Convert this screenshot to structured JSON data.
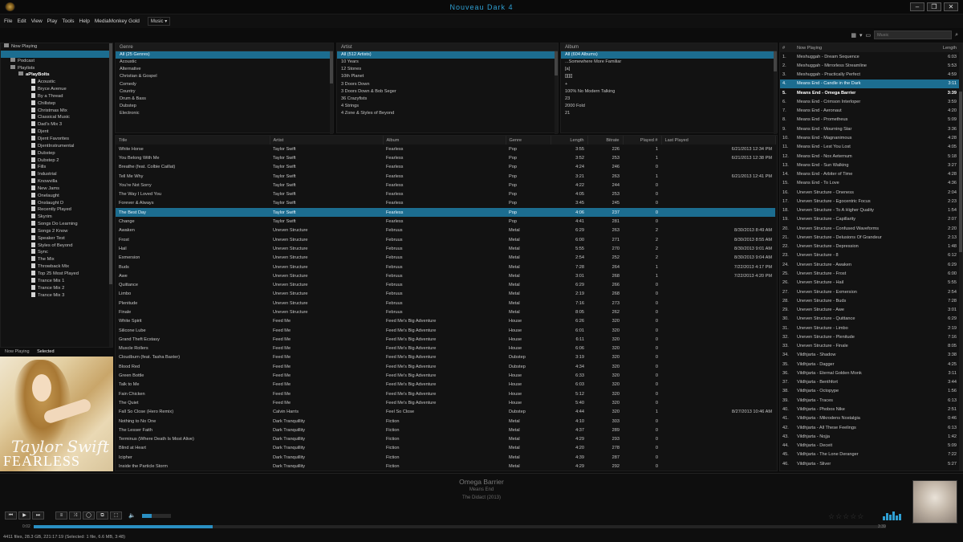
{
  "window": {
    "title": "Nouveau Dark 4"
  },
  "menu": [
    "File",
    "Edit",
    "View",
    "Play",
    "Tools",
    "Help",
    "MediaMonkey Gold"
  ],
  "menu_dropdown": "Music",
  "toolbar": {
    "search_placeholder": "Music"
  },
  "colors": {
    "accent": "#1c6d90",
    "highlight_text": "#2f9fd2",
    "background": "#0c0c0c"
  },
  "tree": {
    "items": [
      {
        "label": "Now Playing",
        "type": "node"
      },
      {
        "label": "",
        "type": "selected"
      },
      {
        "label": "Podcast",
        "type": "node"
      },
      {
        "label": "Playlists",
        "type": "node"
      },
      {
        "label": "aPlayBolts",
        "type": "bold"
      },
      {
        "label": "Acoustic",
        "type": "doc"
      },
      {
        "label": "Bryce Avenue",
        "type": "doc"
      },
      {
        "label": "By a Thread",
        "type": "doc"
      },
      {
        "label": "Chillstep",
        "type": "doc"
      },
      {
        "label": "Christmas Mix",
        "type": "doc"
      },
      {
        "label": "Classical Music",
        "type": "doc"
      },
      {
        "label": "Dad's Mix 3",
        "type": "doc"
      },
      {
        "label": "Djent",
        "type": "doc"
      },
      {
        "label": "Djent Favorites",
        "type": "doc"
      },
      {
        "label": "DjentInstrumental",
        "type": "doc"
      },
      {
        "label": "Dubstep",
        "type": "doc"
      },
      {
        "label": "Dubstep 2",
        "type": "doc"
      },
      {
        "label": "Fills",
        "type": "doc"
      },
      {
        "label": "Industrial",
        "type": "doc"
      },
      {
        "label": "Knowvilla",
        "type": "doc"
      },
      {
        "label": "New Jams",
        "type": "doc"
      },
      {
        "label": "Onelaught",
        "type": "doc"
      },
      {
        "label": "Onslaught D",
        "type": "doc"
      },
      {
        "label": "Recently Played",
        "type": "doc"
      },
      {
        "label": "Skyrim",
        "type": "doc"
      },
      {
        "label": "Songs Do Learning",
        "type": "doc"
      },
      {
        "label": "Songs 2 Know",
        "type": "doc"
      },
      {
        "label": "Speaker Test",
        "type": "doc"
      },
      {
        "label": "Styles of Beyond",
        "type": "doc"
      },
      {
        "label": "Sync",
        "type": "doc"
      },
      {
        "label": "The Mix",
        "type": "doc"
      },
      {
        "label": "Throwback Mix",
        "type": "doc"
      },
      {
        "label": "Top 25 Most Played",
        "type": "doc"
      },
      {
        "label": "Trance Mix 1",
        "type": "doc"
      },
      {
        "label": "Trance Mix 2",
        "type": "doc"
      },
      {
        "label": "Trance Mix 3",
        "type": "doc"
      }
    ]
  },
  "side_tabs": {
    "now_playing": "Now Playing",
    "selected": "Selected"
  },
  "album_art": {
    "signature": "Taylor Swift",
    "title": "FEARLESS"
  },
  "filters": {
    "genre": {
      "header": "Genre",
      "items": [
        "All (25 Genres)",
        "Acoustic",
        "Alternative",
        "Christian & Gospel",
        "Comedy",
        "Country",
        "Drum & Bass",
        "Dubstep",
        "Electronic"
      ]
    },
    "artist": {
      "header": "Artist",
      "items": [
        "All (512 Artists)",
        "10 Years",
        "12 Stones",
        "10th Planet",
        "3 Doors Down",
        "3 Doors Down & Bob Seger",
        "36 Crazyfists",
        "4 Strings",
        "4 Zone & Styles of Beyond"
      ]
    },
    "album": {
      "header": "Album",
      "items": [
        "All (604 Albums)",
        "...Somewhere More Familiar",
        "[a]",
        "[][][]",
        "+",
        "100% No Modern Talking",
        "23",
        "2000 Fold",
        "21"
      ]
    }
  },
  "tracklist": {
    "columns": [
      "Title",
      "Artist",
      "Album",
      "Genre",
      "Length",
      "Bitrate",
      "Played #",
      "Last Played"
    ],
    "selected_index": 7,
    "rows": [
      [
        "White Horse",
        "Taylor Swift",
        "Fearless",
        "Pop",
        "3:55",
        "226",
        "1",
        "6/21/2013 12:34 PM"
      ],
      [
        "You Belong With Me",
        "Taylor Swift",
        "Fearless",
        "Pop",
        "3:52",
        "253",
        "1",
        "6/21/2013 12:38 PM"
      ],
      [
        "Breathe (feat. Colbie Caillat)",
        "Taylor Swift",
        "Fearless",
        "Pop",
        "4:24",
        "246",
        "0",
        ""
      ],
      [
        "Tell Me Why",
        "Taylor Swift",
        "Fearless",
        "Pop",
        "3:21",
        "263",
        "1",
        "6/21/2013 12:41 PM"
      ],
      [
        "You're Not Sorry",
        "Taylor Swift",
        "Fearless",
        "Pop",
        "4:22",
        "244",
        "0",
        ""
      ],
      [
        "The Way I Loved You",
        "Taylor Swift",
        "Fearless",
        "Pop",
        "4:05",
        "253",
        "0",
        ""
      ],
      [
        "Forever & Always",
        "Taylor Swift",
        "Fearless",
        "Pop",
        "3:45",
        "245",
        "0",
        ""
      ],
      [
        "The Best Day",
        "Taylor Swift",
        "Fearless",
        "Pop",
        "4:06",
        "237",
        "0",
        ""
      ],
      [
        "Change",
        "Taylor Swift",
        "Fearless",
        "Pop",
        "4:41",
        "281",
        "0",
        ""
      ],
      [
        "Awaken",
        "Uneven Structure",
        "Februus",
        "Metal",
        "6:29",
        "263",
        "2",
        "8/30/2013 8:49 AM"
      ],
      [
        "Frost",
        "Uneven Structure",
        "Februus",
        "Metal",
        "6:00",
        "271",
        "2",
        "8/30/2013 8:55 AM"
      ],
      [
        "Hail",
        "Uneven Structure",
        "Februus",
        "Metal",
        "5:55",
        "270",
        "2",
        "8/30/2013 9:01 AM"
      ],
      [
        "Exmersion",
        "Uneven Structure",
        "Februus",
        "Metal",
        "2:54",
        "252",
        "2",
        "8/30/2013 9:04 AM"
      ],
      [
        "Buds",
        "Uneven Structure",
        "Februus",
        "Metal",
        "7:28",
        "264",
        "1",
        "7/22/2013 4:17 PM"
      ],
      [
        "Awe",
        "Uneven Structure",
        "Februus",
        "Metal",
        "3:01",
        "268",
        "1",
        "7/22/2013 4:20 PM"
      ],
      [
        "Quittance",
        "Uneven Structure",
        "Februus",
        "Metal",
        "6:29",
        "266",
        "0",
        ""
      ],
      [
        "Limbo",
        "Uneven Structure",
        "Februus",
        "Metal",
        "2:19",
        "268",
        "0",
        ""
      ],
      [
        "Plenitude",
        "Uneven Structure",
        "Februus",
        "Metal",
        "7:16",
        "273",
        "0",
        ""
      ],
      [
        "Finale",
        "Uneven Structure",
        "Februus",
        "Metal",
        "8:05",
        "262",
        "0",
        ""
      ],
      [
        "White Spirit",
        "Feed Me",
        "Feed Me's Big Adventure",
        "House",
        "6:26",
        "320",
        "0",
        ""
      ],
      [
        "Silicone Lube",
        "Feed Me",
        "Feed Me's Big Adventure",
        "House",
        "6:01",
        "320",
        "0",
        ""
      ],
      [
        "Grand Theft Ecstasy",
        "Feed Me",
        "Feed Me's Big Adventure",
        "House",
        "6:11",
        "320",
        "0",
        ""
      ],
      [
        "Muscle Rollers",
        "Feed Me",
        "Feed Me's Big Adventure",
        "House",
        "6:06",
        "320",
        "0",
        ""
      ],
      [
        "Cloudburn (feat. Tasha Baxter)",
        "Feed Me",
        "Feed Me's Big Adventure",
        "Dubstep",
        "3:19",
        "320",
        "0",
        ""
      ],
      [
        "Blood Red",
        "Feed Me",
        "Feed Me's Big Adventure",
        "Dubstep",
        "4:34",
        "320",
        "0",
        ""
      ],
      [
        "Green Bottle",
        "Feed Me",
        "Feed Me's Big Adventure",
        "House",
        "6:33",
        "320",
        "0",
        ""
      ],
      [
        "Talk to Me",
        "Feed Me",
        "Feed Me's Big Adventure",
        "House",
        "6:03",
        "320",
        "0",
        ""
      ],
      [
        "Fain Chicken",
        "Feed Me",
        "Feed Me's Big Adventure",
        "House",
        "5:12",
        "320",
        "0",
        ""
      ],
      [
        "The Quiet",
        "Feed Me",
        "Feed Me's Big Adventure",
        "House",
        "5:40",
        "320",
        "0",
        ""
      ],
      [
        "Fall So Close (Hero Remix)",
        "Calvin Harris",
        "Feel So Close",
        "Dubstep",
        "4:44",
        "320",
        "1",
        "8/27/2013 10:46 AM"
      ],
      [
        "Nothing to No One",
        "Dark Tranquillity",
        "Fiction",
        "Metal",
        "4:10",
        "303",
        "0",
        ""
      ],
      [
        "The Lesser Faith",
        "Dark Tranquillity",
        "Fiction",
        "Metal",
        "4:37",
        "289",
        "0",
        ""
      ],
      [
        "Terminus (Where Death Is Most Alive)",
        "Dark Tranquillity",
        "Fiction",
        "Metal",
        "4:29",
        "293",
        "0",
        ""
      ],
      [
        "Blind at Heart",
        "Dark Tranquillity",
        "Fiction",
        "Metal",
        "4:20",
        "278",
        "0",
        ""
      ],
      [
        "Icipher",
        "Dark Tranquillity",
        "Fiction",
        "Metal",
        "4:39",
        "287",
        "0",
        ""
      ],
      [
        "Inside the Particle Storm",
        "Dark Tranquillity",
        "Fiction",
        "Metal",
        "4:29",
        "292",
        "0",
        ""
      ]
    ]
  },
  "nowplaying": {
    "columns": [
      "#",
      "Now Playing",
      "Length"
    ],
    "selected_index": 3,
    "bold_index": 4,
    "rows": [
      [
        "1.",
        "Meshuggah - Dream Sequence",
        "6:03"
      ],
      [
        "2.",
        "Meshuggah - Mirrorless Streamline",
        "5:53"
      ],
      [
        "3.",
        "Meshuggah - Practically Perfect",
        "4:59"
      ],
      [
        "4.",
        "Means End - Candle in the Dark",
        "3:11"
      ],
      [
        "5.",
        "Means End - Omega Barrier",
        "3:39"
      ],
      [
        "6.",
        "Means End - Crimson Interloper",
        "3:59"
      ],
      [
        "7.",
        "Means End - Aeronaut",
        "4:20"
      ],
      [
        "8.",
        "Means End - Prometheus",
        "5:09"
      ],
      [
        "9.",
        "Means End - Mourning Star",
        "3:36"
      ],
      [
        "10.",
        "Means End - Magnanimous",
        "4:28"
      ],
      [
        "11.",
        "Means End - Lest You Lost",
        "4:05"
      ],
      [
        "12.",
        "Means End - Nox Aeternum",
        "5:18"
      ],
      [
        "13.",
        "Means End - Sun Walking",
        "3:27"
      ],
      [
        "14.",
        "Means End - Arbiter of Time",
        "4:28"
      ],
      [
        "15.",
        "Means End - To Love",
        "4:36"
      ],
      [
        "16.",
        "Uneven Structure - Oneness",
        "2:04"
      ],
      [
        "17.",
        "Uneven Structure - Egocentric Focus",
        "2:23"
      ],
      [
        "18.",
        "Uneven Structure - To A Higher Quality",
        "1:54"
      ],
      [
        "19.",
        "Uneven Structure - Capillarity",
        "2:07"
      ],
      [
        "20.",
        "Uneven Structure - Confused Waveforms",
        "2:20"
      ],
      [
        "21.",
        "Uneven Structure - Delusions Of Grandeur",
        "2:13"
      ],
      [
        "22.",
        "Uneven Structure - Depression",
        "1:48"
      ],
      [
        "23.",
        "Uneven Structure - 8",
        "6:12"
      ],
      [
        "24.",
        "Uneven Structure - Awaken",
        "6:29"
      ],
      [
        "25.",
        "Uneven Structure - Frost",
        "6:00"
      ],
      [
        "26.",
        "Uneven Structure - Hail",
        "5:55"
      ],
      [
        "27.",
        "Uneven Structure - Exmersion",
        "2:54"
      ],
      [
        "28.",
        "Uneven Structure - Buds",
        "7:28"
      ],
      [
        "29.",
        "Uneven Structure - Awe",
        "3:01"
      ],
      [
        "30.",
        "Uneven Structure - Quittance",
        "6:29"
      ],
      [
        "31.",
        "Uneven Structure - Limbo",
        "2:19"
      ],
      [
        "32.",
        "Uneven Structure - Plenitude",
        "7:16"
      ],
      [
        "33.",
        "Uneven Structure - Finale",
        "8:05"
      ],
      [
        "34.",
        "Vildhjarta - Shadow",
        "3:38"
      ],
      [
        "35.",
        "Vildhjarta - Dagger",
        "4:25"
      ],
      [
        "36.",
        "Vildhjarta - Eternal Golden Monk",
        "3:11"
      ],
      [
        "37.",
        "Vildhjarta - Benthfort",
        "3:44"
      ],
      [
        "38.",
        "Vildhjarta - Octopype",
        "1:56"
      ],
      [
        "39.",
        "Vildhjarta - Traces",
        "6:13"
      ],
      [
        "40.",
        "Vildhjarta - Phobos Nike",
        "2:51"
      ],
      [
        "41.",
        "Vildhjarta - Mikrodens Nostalgia",
        "0:46"
      ],
      [
        "42.",
        "Vildhjarta - All These Feelings",
        "6:13"
      ],
      [
        "43.",
        "Vildhjarta - Nojja",
        "1:42"
      ],
      [
        "44.",
        "Vildhjarta - Deceit",
        "5:09"
      ],
      [
        "45.",
        "Vildhjarta - The Lone Deranger",
        "7:22"
      ],
      [
        "46.",
        "Vildhjarta - Sliver",
        "5:27"
      ]
    ]
  },
  "player": {
    "track": "Omega Barrier",
    "artist": "Means End",
    "album": "The Didact (2013)",
    "elapsed": "0:02",
    "remaining": "3:39",
    "progress": 0.21,
    "volume": 0.35,
    "rating_stars": "☆☆☆☆☆",
    "buttons": [
      "⏮",
      "▶",
      "⏭",
      "≡",
      "⤨",
      "◯",
      "⧉",
      "⬚"
    ],
    "volume_icon": "🔈"
  },
  "status": "4411 files, 28.3 GB, 221:17:19 (Selected: 1 file, 6.6 MB, 3:48)"
}
